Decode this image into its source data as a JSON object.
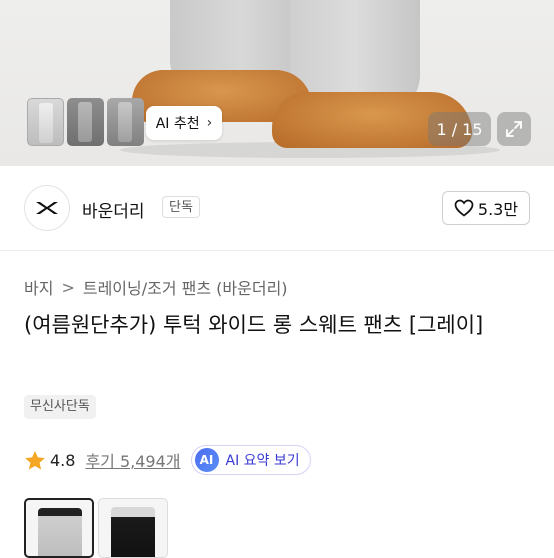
{
  "hero": {
    "ai_recommend_label": "AI 추천",
    "pager_text": "1 / 15",
    "thumbnails": [
      "thumb-gray-front",
      "thumb-gray-side",
      "thumb-gray-back"
    ]
  },
  "brand": {
    "name": "바운더리",
    "badge": "단독",
    "likes": "5.3만"
  },
  "breadcrumb": {
    "items": [
      "바지",
      "트레이닝/조거 팬츠 (바운더리)"
    ],
    "separator": ">"
  },
  "product": {
    "title": "(여름원단추가) 투턱 와이드 롱 스웨트 팬츠 [그레이]",
    "tag": "무신사단독",
    "rating": "4.8",
    "reviews": "후기 5,494개",
    "ai_badge": "AI",
    "ai_summary_label": "AI 요약 보기"
  },
  "colors": {
    "accent_star": "#f5a623",
    "ai_blue": "#3a3ad6",
    "options": [
      "light-gray",
      "black"
    ]
  }
}
